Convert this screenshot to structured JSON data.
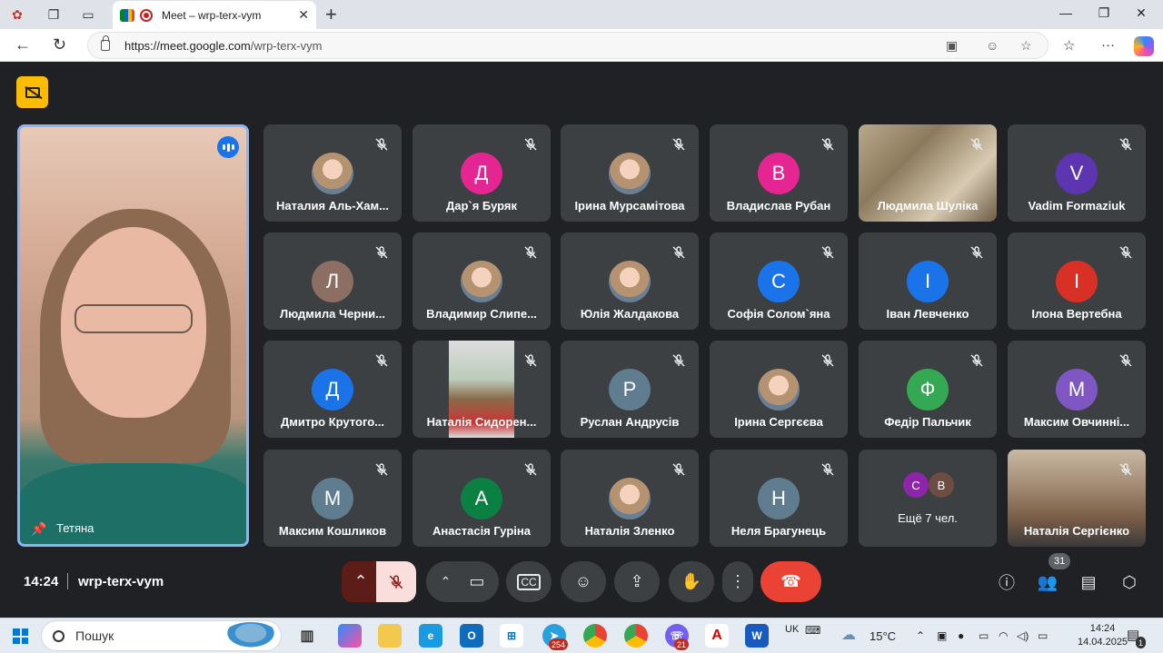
{
  "browser": {
    "tab_title": "Meet – wrp-terx-vym",
    "url_host": "https://meet.google.com",
    "url_path": "/wrp-terx-vym"
  },
  "main_tile": {
    "name": "Тетяна"
  },
  "tiles": [
    {
      "name": "Наталия Аль-Хам...",
      "avatar_letter": "",
      "avatar_color": "#d9cbb8",
      "kind": "photo"
    },
    {
      "name": "Дар`я Буряк",
      "avatar_letter": "Д",
      "avatar_color": "#e52592",
      "kind": "letter"
    },
    {
      "name": "Ірина Мурсамітова",
      "avatar_letter": "",
      "avatar_color": "#c9b39a",
      "kind": "photo"
    },
    {
      "name": "Владислав Рубан",
      "avatar_letter": "В",
      "avatar_color": "#e52592",
      "kind": "letter"
    },
    {
      "name": "Людмила Шуліка",
      "avatar_letter": "",
      "avatar_color": "",
      "kind": "video"
    },
    {
      "name": "Vadim Formaziuk",
      "avatar_letter": "V",
      "avatar_color": "#5e35b1",
      "kind": "letter"
    },
    {
      "name": "Людмила Черни...",
      "avatar_letter": "Л",
      "avatar_color": "#8d6e63",
      "kind": "letter"
    },
    {
      "name": "Владимир Слипе...",
      "avatar_letter": "",
      "avatar_color": "#7c8b6a",
      "kind": "photo"
    },
    {
      "name": "Юлія Жалдакова",
      "avatar_letter": "",
      "avatar_color": "#e8d5c8",
      "kind": "photo"
    },
    {
      "name": "Софія Солом`яна",
      "avatar_letter": "С",
      "avatar_color": "#1a73e8",
      "kind": "letter"
    },
    {
      "name": "Іван Левченко",
      "avatar_letter": "І",
      "avatar_color": "#1a73e8",
      "kind": "letter"
    },
    {
      "name": "Ілона Вертебна",
      "avatar_letter": "І",
      "avatar_color": "#d93025",
      "kind": "letter"
    },
    {
      "name": "Дмитро Крутого...",
      "avatar_letter": "Д",
      "avatar_color": "#1a73e8",
      "kind": "letter"
    },
    {
      "name": "Наталія Сидорен...",
      "avatar_letter": "",
      "avatar_color": "",
      "kind": "video-narrow"
    },
    {
      "name": "Руслан Андрусів",
      "avatar_letter": "Р",
      "avatar_color": "#5f7d8f",
      "kind": "letter"
    },
    {
      "name": "Ірина Сергєєва",
      "avatar_letter": "",
      "avatar_color": "#4a7d3f",
      "kind": "photo"
    },
    {
      "name": "Федір Пальчик",
      "avatar_letter": "Ф",
      "avatar_color": "#34a853",
      "kind": "letter"
    },
    {
      "name": "Максим Овчинні...",
      "avatar_letter": "М",
      "avatar_color": "#7e57c2",
      "kind": "letter"
    },
    {
      "name": "Максим Кошликов",
      "avatar_letter": "М",
      "avatar_color": "#5f7d8f",
      "kind": "letter"
    },
    {
      "name": "Анастасія Гуріна",
      "avatar_letter": "А",
      "avatar_color": "#0b8043",
      "kind": "letter"
    },
    {
      "name": "Наталія Зленко",
      "avatar_letter": "",
      "avatar_color": "#e8d2c0",
      "kind": "photo"
    },
    {
      "name": "Неля Брагунець",
      "avatar_letter": "Н",
      "avatar_color": "#5f7d8f",
      "kind": "letter"
    },
    {
      "name": "Ещё 7 чел.",
      "avatar_letter": "",
      "avatar_color": "",
      "kind": "more",
      "more_letters": [
        "С",
        "В"
      ],
      "more_colors": [
        "#8e24aa",
        "#6d4c41"
      ]
    },
    {
      "name": "Наталія Сергієнко",
      "avatar_letter": "",
      "avatar_color": "",
      "kind": "video2"
    }
  ],
  "meeting": {
    "time": "14:24",
    "code": "wrp-terx-vym",
    "participants_count": "31"
  },
  "taskbar": {
    "search_label": "Пошук",
    "lang": "UK",
    "weather": "15°C",
    "time": "14:24",
    "date": "14.04.2025",
    "telegram_badge": "254",
    "viber_badge": "21",
    "notif_badge": "1"
  }
}
